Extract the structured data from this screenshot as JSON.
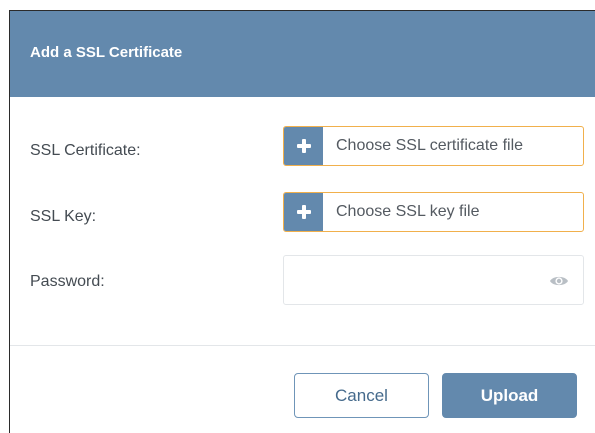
{
  "dialog": {
    "title": "Add a SSL Certificate"
  },
  "form": {
    "certificate": {
      "label": "SSL Certificate:",
      "placeholder": "Choose SSL certificate file"
    },
    "key": {
      "label": "SSL Key:",
      "placeholder": "Choose SSL key file"
    },
    "password": {
      "label": "Password:",
      "value": ""
    }
  },
  "buttons": {
    "cancel_label": "Cancel",
    "upload_label": "Upload"
  },
  "icons": {
    "add": "plus-icon",
    "reveal": "eye-icon"
  },
  "colors": {
    "accent": "#6389ad",
    "focus_border": "#f1b04c"
  }
}
